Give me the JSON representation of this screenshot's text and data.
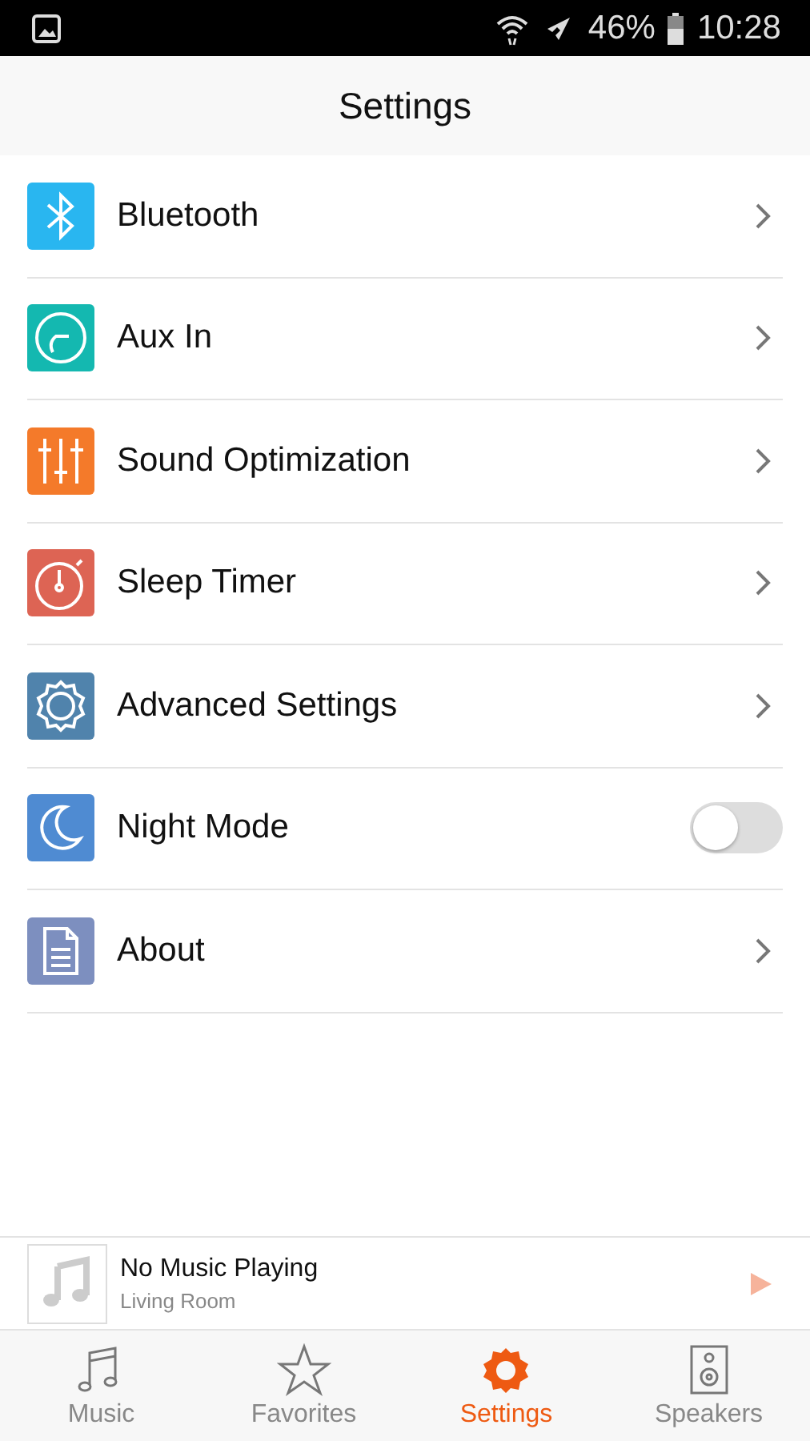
{
  "status_bar": {
    "battery": "46%",
    "time": "10:28"
  },
  "header": {
    "title": "Settings"
  },
  "items": [
    {
      "label": "Bluetooth",
      "kind": "link",
      "color": "#29b6f0"
    },
    {
      "label": "Aux In",
      "kind": "link",
      "color": "#14b8b0"
    },
    {
      "label": "Sound Optimization",
      "kind": "link",
      "color": "#f47a2a"
    },
    {
      "label": "Sleep Timer",
      "kind": "link",
      "color": "#dd6454"
    },
    {
      "label": "Advanced Settings",
      "kind": "link",
      "color": "#5083ac"
    },
    {
      "label": "Night Mode",
      "kind": "toggle",
      "color": "#4f8bd2",
      "on": false
    },
    {
      "label": "About",
      "kind": "link",
      "color": "#7d8fbf"
    }
  ],
  "now_playing": {
    "title": "No Music Playing",
    "subtitle": "Living Room"
  },
  "tabs": [
    {
      "label": "Music",
      "selected": false
    },
    {
      "label": "Favorites",
      "selected": false
    },
    {
      "label": "Settings",
      "selected": true
    },
    {
      "label": "Speakers",
      "selected": false
    }
  ]
}
